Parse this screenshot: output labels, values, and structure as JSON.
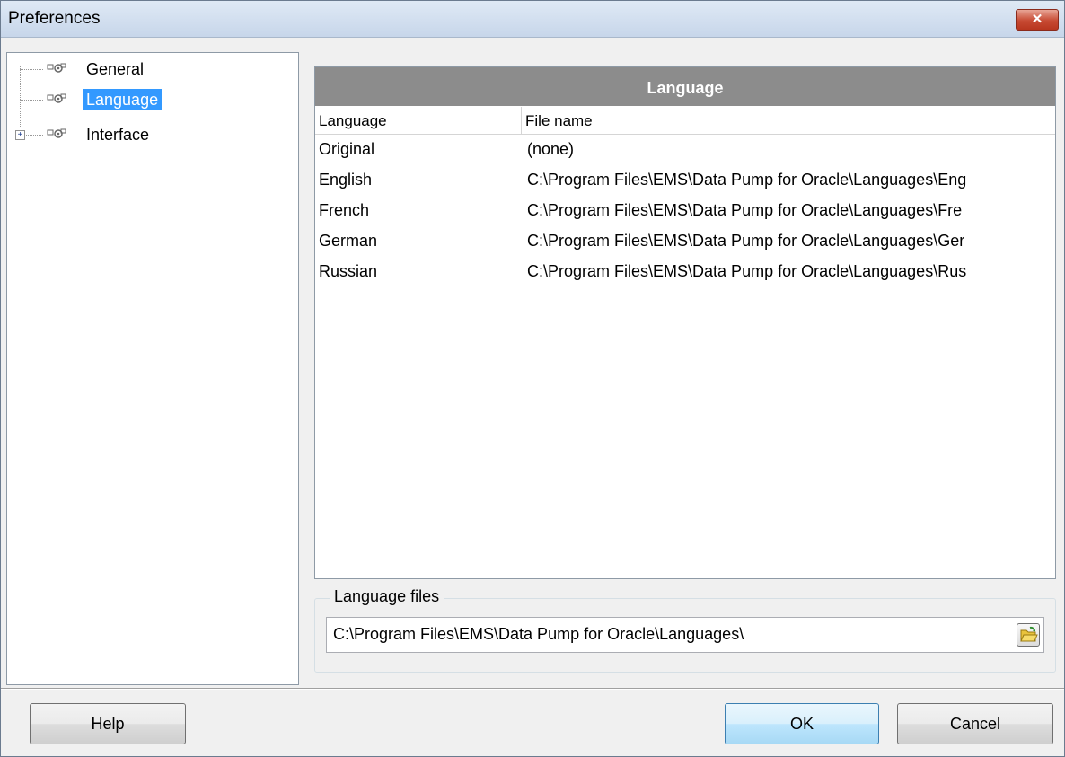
{
  "window": {
    "title": "Preferences",
    "close_label": "✕"
  },
  "tree": {
    "items": [
      {
        "label": "General",
        "selected": false,
        "expandable": false
      },
      {
        "label": "Language",
        "selected": true,
        "expandable": false
      },
      {
        "label": "Interface",
        "selected": false,
        "expandable": true,
        "expander_glyph": "+"
      }
    ]
  },
  "panel": {
    "title": "Language",
    "columns": [
      "Language",
      "File name"
    ],
    "rows": [
      {
        "language": "Original",
        "file": "(none)"
      },
      {
        "language": "English",
        "file": "C:\\Program Files\\EMS\\Data Pump for Oracle\\Languages\\Eng"
      },
      {
        "language": "French",
        "file": "C:\\Program Files\\EMS\\Data Pump for Oracle\\Languages\\Fre"
      },
      {
        "language": "German",
        "file": "C:\\Program Files\\EMS\\Data Pump for Oracle\\Languages\\Ger"
      },
      {
        "language": "Russian",
        "file": "C:\\Program Files\\EMS\\Data Pump for Oracle\\Languages\\Rus"
      }
    ]
  },
  "language_files": {
    "group_label": "Language files",
    "path": "C:\\Program Files\\EMS\\Data Pump for Oracle\\Languages\\",
    "browse_icon": "folder-open-icon"
  },
  "buttons": {
    "help": "Help",
    "ok": "OK",
    "cancel": "Cancel"
  },
  "colors": {
    "selection": "#3399ff",
    "panel_header": "#8c8c8c",
    "close_button": "#c74a33"
  }
}
